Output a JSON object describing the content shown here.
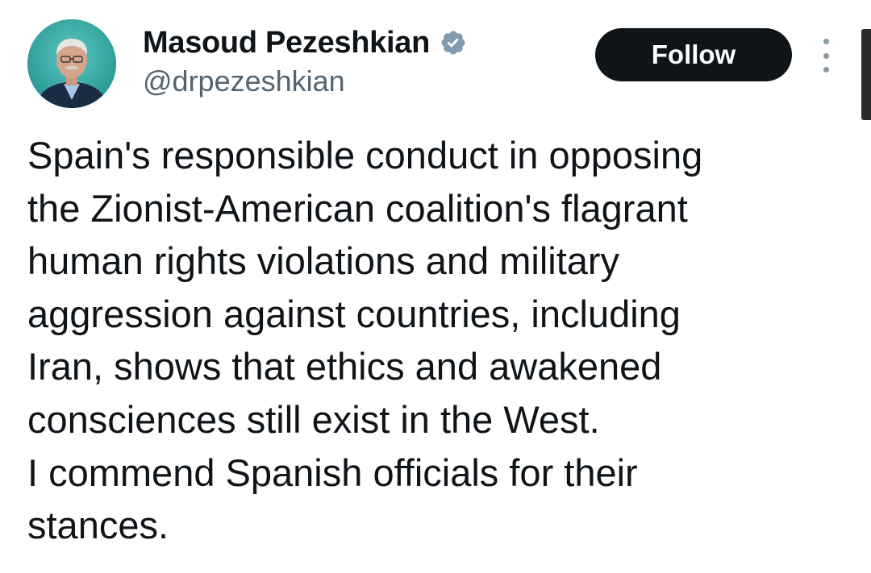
{
  "author": {
    "display_name": "Masoud Pezeshkian",
    "handle": "@drpezeshkian",
    "verified": true
  },
  "actions": {
    "follow_label": "Follow"
  },
  "tweet": {
    "lines": [
      "Spain's responsible conduct in opposing",
      "the Zionist-American coalition's flagrant",
      "human rights violations and military",
      "aggression against countries, including",
      "Iran, shows that ethics and awakened",
      "consciences still exist in the West.",
      "I commend Spanish officials for their",
      "stances."
    ]
  },
  "icons": {
    "verified": "verified-badge-icon",
    "more": "more-options-icon"
  },
  "colors": {
    "text": "#0f1419",
    "secondary_text": "#536471",
    "follow_button_bg": "#0f1419",
    "follow_button_text": "#ffffff",
    "verified_badge": "#829aab",
    "avatar_bg": "#2aa9a6"
  }
}
